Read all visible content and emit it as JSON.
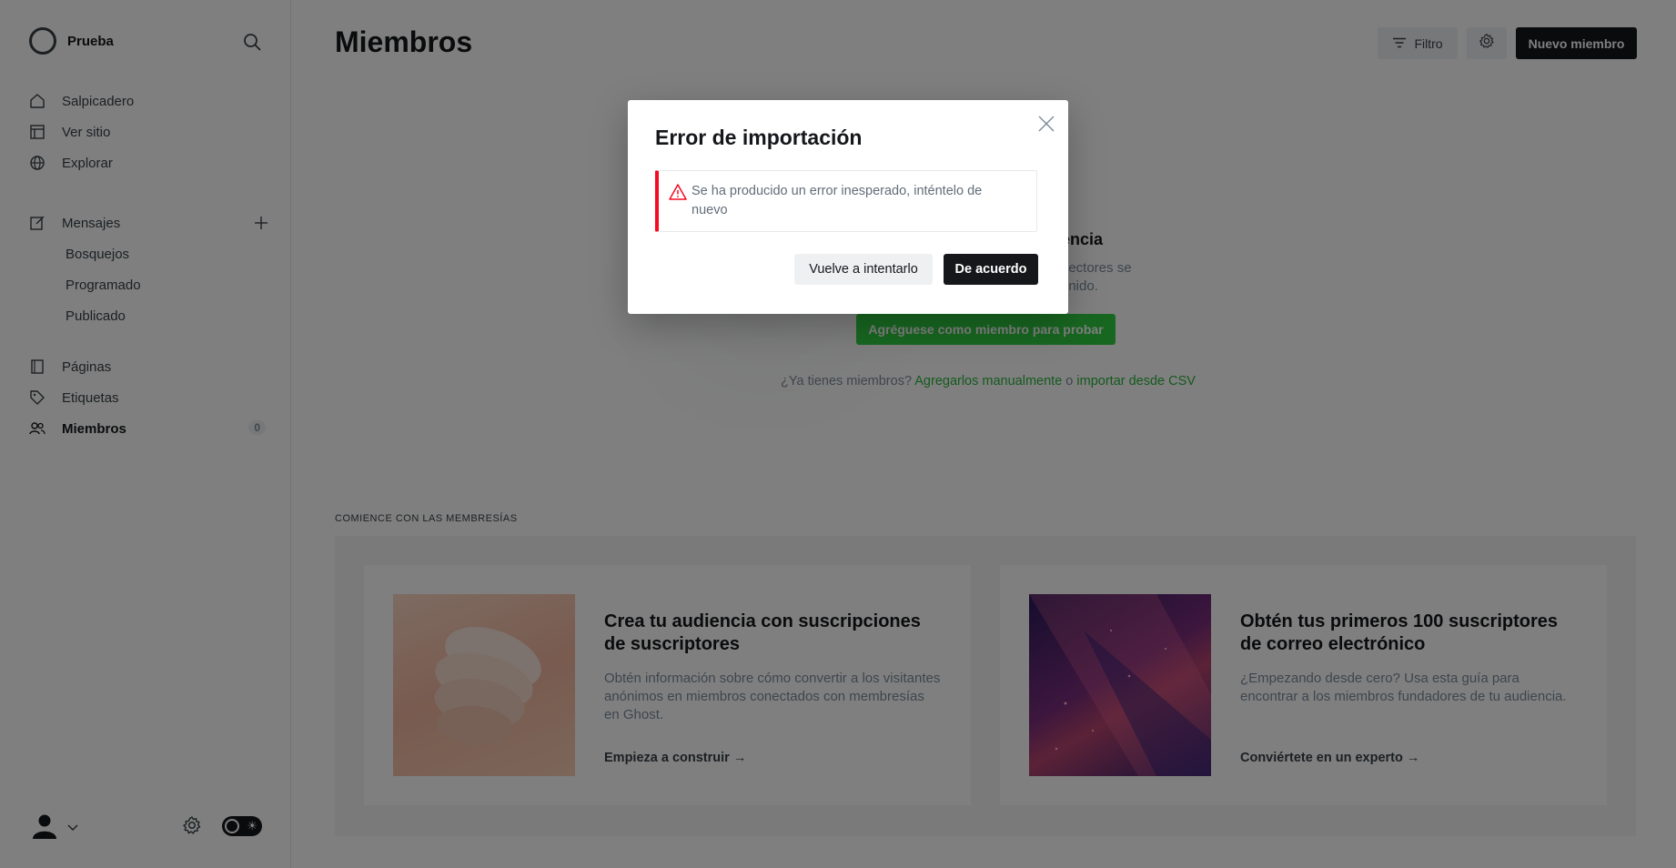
{
  "sidebar": {
    "site_name": "Prueba",
    "primary": [
      {
        "label": "Salpicadero",
        "icon": "home-icon"
      },
      {
        "label": "Ver sitio",
        "icon": "layout-icon"
      },
      {
        "label": "Explorar",
        "icon": "globe-icon"
      }
    ],
    "posts": {
      "label": "Mensajes",
      "icon": "pencil-icon"
    },
    "posts_sub": [
      {
        "label": "Bosquejos"
      },
      {
        "label": "Programado"
      },
      {
        "label": "Publicado"
      }
    ],
    "secondary": [
      {
        "label": "Páginas",
        "icon": "page-icon"
      },
      {
        "label": "Etiquetas",
        "icon": "tag-icon"
      },
      {
        "label": "Miembros",
        "icon": "members-icon",
        "count": "0"
      }
    ]
  },
  "header": {
    "title": "Miembros",
    "filter_label": "Filtro",
    "new_member_label": "Nuevo miembro"
  },
  "empty_state": {
    "heading_visible": "encia",
    "desc_line1": "lectores se",
    "desc_line2": "enido.",
    "add_self_label": "Agréguese como miembro para probar",
    "have_members_prefix": "¿Ya tienes miembros?",
    "add_manually": "Agregarlos manualmente",
    "or": "o",
    "import_csv": "importar desde CSV"
  },
  "memberships": {
    "section_label": "COMIENCE CON LAS MEMBRESÍAS",
    "cards": [
      {
        "title": "Crea tu audiencia con suscripciones de suscriptores",
        "description": "Obtén información sobre cómo convertir a los visitantes anónimos en miembros conectados con membresías en Ghost.",
        "link": "Empieza a construir →"
      },
      {
        "title": "Obtén tus primeros 100 suscriptores de correo electrónico",
        "description": "¿Empezando desde cero? Usa esta guía para encontrar a los miembros fundadores de tu audiencia.",
        "link": "Conviértete en un experto →"
      }
    ]
  },
  "modal": {
    "title": "Error de importación",
    "error_message": "Se ha producido un error inesperado, inténtelo de nuevo",
    "retry_label": "Vuelve a intentarlo",
    "ok_label": "De acuerdo"
  },
  "colors": {
    "accent_green": "#30cf43",
    "error_red": "#f50b23",
    "dark": "#15171a"
  }
}
